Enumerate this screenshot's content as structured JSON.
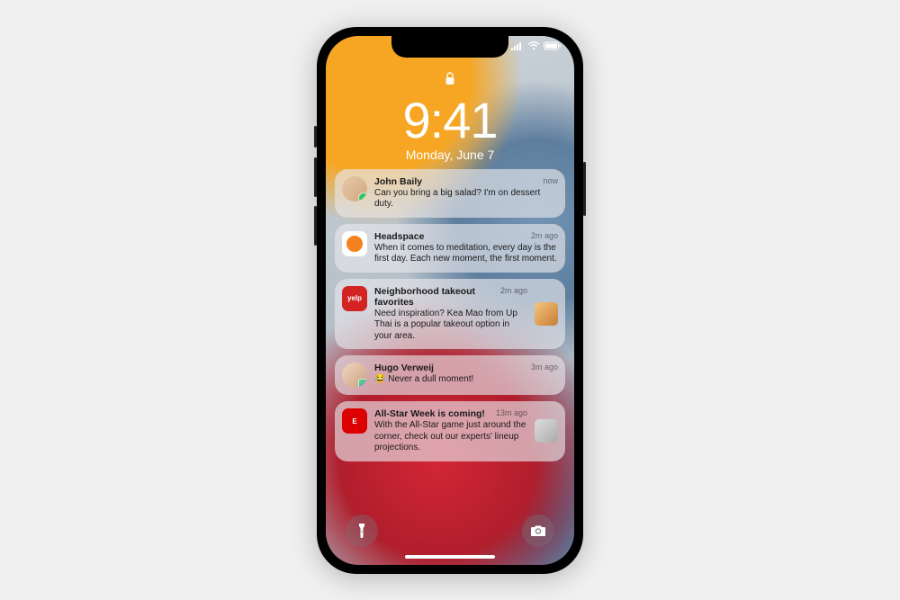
{
  "status": {
    "time": "9:41",
    "date": "Monday, June 7"
  },
  "notifications": [
    {
      "title": "John Baily",
      "body": "Can you bring a big salad? I'm on dessert duty.",
      "time": "now",
      "icon": "avatar-john",
      "icon_shape": "round",
      "badge": "messages"
    },
    {
      "title": "Headspace",
      "body": "When it comes to meditation, every day is the first day. Each new moment, the first moment.",
      "time": "2m ago",
      "icon": "headspace"
    },
    {
      "title": "Neighborhood takeout favorites",
      "body": "Need inspiration? Kea Mao from Up Thai is a popular takeout option in your area.",
      "time": "2m ago",
      "icon": "yelp",
      "icon_text": "yelp",
      "thumbnail": "food"
    },
    {
      "title": "Hugo Verweij",
      "body": "😂 Never a dull moment!",
      "time": "3m ago",
      "icon": "avatar-hugo",
      "icon_shape": "round",
      "badge": "findmy"
    },
    {
      "title": "All-Star Week is coming!",
      "body": "With the All-Star game just around the corner, check out our experts' lineup projections.",
      "time": "13m ago",
      "icon": "espn",
      "icon_text": "E",
      "thumbnail": "espn"
    }
  ],
  "dock": {
    "flashlight": "flashlight",
    "camera": "camera"
  }
}
